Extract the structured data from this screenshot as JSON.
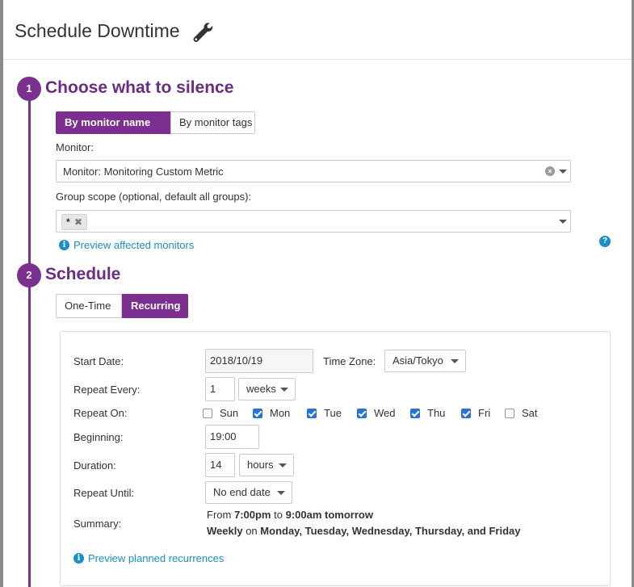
{
  "header": {
    "title": "Schedule Downtime",
    "icon": "wrench-icon"
  },
  "step1": {
    "number": "1",
    "title": "Choose what to silence",
    "tabs": [
      {
        "label": "By monitor name",
        "active": true
      },
      {
        "label": "By monitor tags",
        "active": false
      }
    ],
    "monitor_label": "Monitor:",
    "monitor_value": "Monitor: Monitoring Custom Metric",
    "group_label": "Group scope (optional, default all groups):",
    "group_tag": "*",
    "preview_link": "Preview affected monitors",
    "help": "?"
  },
  "step2": {
    "number": "2",
    "title": "Schedule",
    "tabs": [
      {
        "label": "One-Time",
        "active": false
      },
      {
        "label": "Recurring",
        "active": true
      }
    ]
  },
  "form": {
    "start_date_label": "Start Date:",
    "start_date_value": "2018/10/19",
    "timezone_label": "Time Zone:",
    "timezone_value": "Asia/Tokyo",
    "repeat_every_label": "Repeat Every:",
    "repeat_every_value": "1",
    "repeat_every_unit": "weeks",
    "repeat_on_label": "Repeat On:",
    "days": [
      {
        "label": "Sun",
        "checked": false
      },
      {
        "label": "Mon",
        "checked": true
      },
      {
        "label": "Tue",
        "checked": true
      },
      {
        "label": "Wed",
        "checked": true
      },
      {
        "label": "Thu",
        "checked": true
      },
      {
        "label": "Fri",
        "checked": true
      },
      {
        "label": "Sat",
        "checked": false
      }
    ],
    "beginning_label": "Beginning:",
    "beginning_value": "19:00",
    "duration_label": "Duration:",
    "duration_value": "14",
    "duration_unit": "hours",
    "repeat_until_label": "Repeat Until:",
    "repeat_until_value": "No end date",
    "summary_label": "Summary:",
    "summary_line1": {
      "from": "From",
      "start": "7:00pm",
      "to": "to",
      "end": "9:00am tomorrow"
    },
    "summary_line2": {
      "freq": "Weekly",
      "on": "on",
      "days": "Monday, Tuesday, Wednesday, Thursday, and Friday"
    },
    "preview_link": "Preview planned recurrences"
  },
  "colors": {
    "accent": "#7b2f8e",
    "link": "#1a8fc7",
    "checkbox": "#2a72d8"
  }
}
